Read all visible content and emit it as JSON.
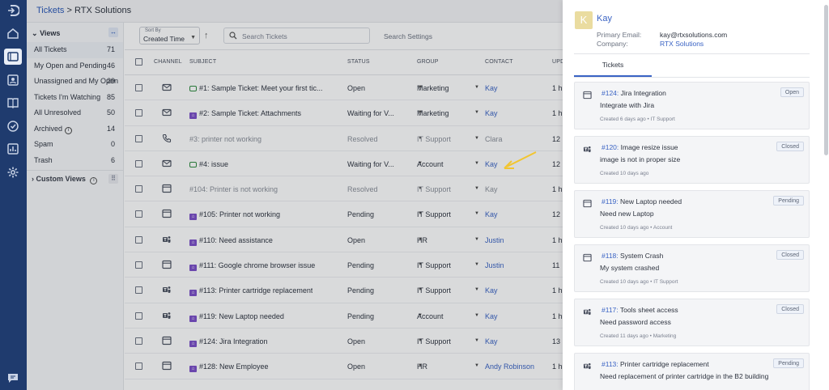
{
  "rail": {
    "icons": [
      "logo-icon",
      "home-icon",
      "tickets-icon",
      "contacts-icon",
      "knowledge-base-icon",
      "tasks-icon",
      "reports-icon",
      "settings-icon",
      "chat-icon"
    ]
  },
  "breadcrumb": {
    "tickets": "Tickets",
    "sep": ">",
    "company": "RTX Solutions"
  },
  "views": {
    "title": "Views",
    "toggle": "↔",
    "items": [
      {
        "label": "All Tickets",
        "count": "71"
      },
      {
        "label": "My Open and Pending",
        "count": "46"
      },
      {
        "label": "Unassigned and My Open",
        "count": "29"
      },
      {
        "label": "Tickets I'm Watching",
        "count": "85"
      },
      {
        "label": "All Unresolved",
        "count": "50"
      },
      {
        "label": "Archived",
        "count": "14"
      },
      {
        "label": "Spam",
        "count": "0"
      },
      {
        "label": "Trash",
        "count": "6"
      }
    ],
    "custom": "Custom Views",
    "custom_toggle": "⠿"
  },
  "toolbar": {
    "sort_label": "Sort By",
    "sort_value": "Created Time",
    "search_placeholder": "Search Tickets",
    "search_settings": "Search Settings"
  },
  "table": {
    "headers": {
      "channel": "CHANNEL",
      "subject": "SUBJECT",
      "status": "STATUS",
      "group": "GROUP",
      "contact": "CONTACT",
      "updated": "UPD"
    },
    "rows": [
      {
        "channel": "email",
        "icon": "chat",
        "subject": "#1: Sample Ticket: Meet your first tic...",
        "status": "Open",
        "group": "Marketing",
        "contact": "Kay",
        "updated": "1 h",
        "muted": false
      },
      {
        "channel": "email",
        "icon": "badge",
        "subject": "#2: Sample Ticket: Attachments",
        "status": "Waiting for V...",
        "group": "Marketing",
        "contact": "Kay",
        "updated": "1 h",
        "muted": false
      },
      {
        "channel": "phone",
        "icon": "",
        "subject": "#3: printer not working",
        "status": "Resolved",
        "group": "IT Support",
        "contact": "Clara",
        "updated": "12",
        "muted": true
      },
      {
        "channel": "email",
        "icon": "chat",
        "subject": "#4: issue",
        "status": "Waiting for V...",
        "group": "Account",
        "contact": "Kay",
        "updated": "12",
        "muted": false
      },
      {
        "channel": "portal",
        "icon": "",
        "subject": "#104: Printer is not working",
        "status": "Resolved",
        "group": "IT Support",
        "contact": "Kay",
        "updated": "1 h",
        "muted": true
      },
      {
        "channel": "portal",
        "icon": "badge",
        "subject": "#105: Printer not working",
        "status": "Pending",
        "group": "IT Support",
        "contact": "Kay",
        "updated": "12",
        "muted": false
      },
      {
        "channel": "teams",
        "icon": "badge",
        "subject": "#110: Need assistance",
        "status": "Open",
        "group": "HR",
        "contact": "Justin",
        "updated": "1 h",
        "muted": false
      },
      {
        "channel": "portal",
        "icon": "badge",
        "subject": "#111: Google chrome browser issue",
        "status": "Pending",
        "group": "IT Support",
        "contact": "Justin",
        "updated": "11",
        "muted": false
      },
      {
        "channel": "teams",
        "icon": "badge",
        "subject": "#113: Printer cartridge replacement",
        "status": "Pending",
        "group": "IT Support",
        "contact": "Kay",
        "updated": "1 h",
        "muted": false
      },
      {
        "channel": "teams",
        "icon": "badge",
        "subject": "#119: New Laptop needed",
        "status": "Pending",
        "group": "Account",
        "contact": "Kay",
        "updated": "1 h",
        "muted": false
      },
      {
        "channel": "portal",
        "icon": "badge",
        "subject": "#124: Jira Integration",
        "status": "Open",
        "group": "IT Support",
        "contact": "Kay",
        "updated": "13",
        "muted": false
      },
      {
        "channel": "portal",
        "icon": "badge",
        "subject": "#128: New Employee",
        "status": "Open",
        "group": "HR",
        "contact": "Andy Robinson",
        "updated": "1 h",
        "muted": false
      }
    ]
  },
  "contact_panel": {
    "initial": "K",
    "name": "Kay",
    "email_label": "Primary Email:",
    "email": "kay@rtxsolutions.com",
    "company_label": "Company:",
    "company": "RTX Solutions",
    "tab": "Tickets",
    "tickets": [
      {
        "channel": "portal",
        "number": "#124:",
        "title": "Jira Integration",
        "desc": "Integrate with Jira",
        "meta": "Created 6 days ago • IT Support",
        "status": "Open"
      },
      {
        "channel": "teams",
        "number": "#120:",
        "title": "Image resize issue",
        "desc": "image is not in proper size",
        "meta": "Created 10 days ago",
        "status": "Closed"
      },
      {
        "channel": "portal",
        "number": "#119:",
        "title": "New Laptop needed",
        "desc": "Need new Laptop",
        "meta": "Created 10 days ago • Account",
        "status": "Pending"
      },
      {
        "channel": "portal",
        "number": "#118:",
        "title": "System Crash",
        "desc": "My system crashed",
        "meta": "Created 10 days ago • IT Support",
        "status": "Closed"
      },
      {
        "channel": "teams",
        "number": "#117:",
        "title": "Tools sheet access",
        "desc": "Need password access",
        "meta": "Created 11 days ago • Marketing",
        "status": "Closed"
      },
      {
        "channel": "teams",
        "number": "#113:",
        "title": "Printer cartridge replacement",
        "desc": "Need replacement of printer cartridge in the B2 building",
        "meta": "",
        "status": "Pending"
      }
    ]
  },
  "colors": {
    "rail": "#1f3b6e",
    "link": "#3a63c4",
    "accent_badge": "#7b4fc9",
    "chat_green": "#2e8b3e",
    "annotation_arrow": "#f2c530"
  }
}
